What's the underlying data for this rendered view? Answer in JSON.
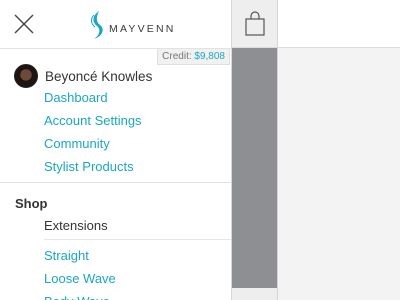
{
  "header": {
    "brand": "MAYVENN",
    "credit_label": "Credit:",
    "credit_value": "$9,808"
  },
  "profile": {
    "name": "Beyoncé Knowles"
  },
  "account_links": [
    {
      "label": "Dashboard"
    },
    {
      "label": "Account Settings"
    },
    {
      "label": "Community"
    },
    {
      "label": "Stylist Products"
    }
  ],
  "shop": {
    "heading": "Shop",
    "subheading": "Extensions",
    "links": [
      {
        "label": "Straight"
      },
      {
        "label": "Loose Wave"
      },
      {
        "label": "Body Wave"
      }
    ]
  },
  "colors": {
    "link": "#1aa7c2",
    "overlay": "#8e8f92"
  },
  "icons": {
    "close": "close-icon",
    "bag": "shopping-bag-icon",
    "logo": "mayvenn-logo-icon"
  }
}
